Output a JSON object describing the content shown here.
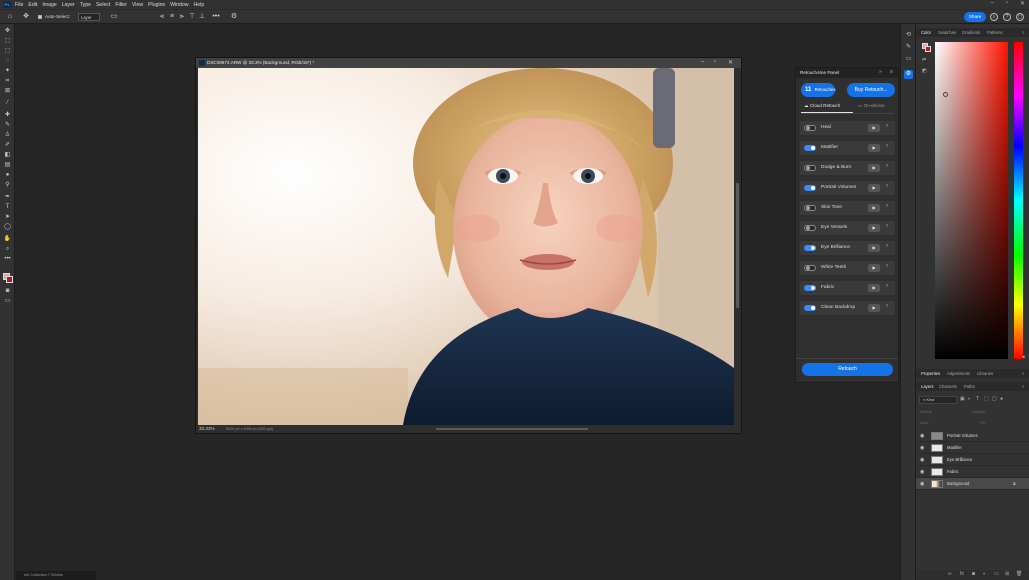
{
  "menu": {
    "items": [
      "File",
      "Edit",
      "Image",
      "Layer",
      "Type",
      "Select",
      "Filter",
      "View",
      "Plugins",
      "Window",
      "Help"
    ]
  },
  "options_bar": {
    "auto_select_label": "Auto-Select:",
    "auto_select_value": "Layer",
    "share_label": "Share"
  },
  "document": {
    "title": "DSC08674.ARW @ 33.3% (Background, RGB/16*) *",
    "zoom": "33.33%",
    "size": "6000 px x 4000 px (300 ppi)"
  },
  "retouch_panel": {
    "title": "Retouch4me Panel",
    "retouches_count": "11",
    "retouches_label": "Retouches",
    "buy_label": "Buy Retouch...",
    "tab_cloud": "Cloud Retouch",
    "tab_device": "On-device",
    "retouch_button": "Retouch",
    "items": [
      {
        "label": "Heal",
        "on": false
      },
      {
        "label": "Mattifier",
        "on": true
      },
      {
        "label": "Dodge & Burn",
        "on": false
      },
      {
        "label": "Portrait Volumes",
        "on": true
      },
      {
        "label": "Skin Tone",
        "on": false
      },
      {
        "label": "Eye Vessels",
        "on": false
      },
      {
        "label": "Eye Brilliance",
        "on": true
      },
      {
        "label": "White Teeth",
        "on": false
      },
      {
        "label": "Fabric",
        "on": true
      },
      {
        "label": "Clean Backdrop",
        "on": true
      }
    ]
  },
  "color_panel": {
    "tabs": [
      "Color",
      "Swatches",
      "Gradients",
      "Patterns"
    ],
    "foreground": "#e6a49a",
    "background": "#b01c20"
  },
  "properties_panel": {
    "tabs": [
      "Properties",
      "Adjustments",
      "Libraries"
    ]
  },
  "layers_panel": {
    "tabs": [
      "Layers",
      "Channels",
      "Paths"
    ],
    "filter_kind": "Kind",
    "blend_mode": "Normal",
    "opacity_label": "Opacity:",
    "lock_label": "Lock:",
    "fill_label": "Fill:",
    "layers": [
      {
        "name": "Portrait Volumes",
        "selected": false
      },
      {
        "name": "Mattifier",
        "selected": false
      },
      {
        "name": "Eye Brilliance",
        "selected": false
      },
      {
        "name": "Fabric",
        "selected": false
      },
      {
        "name": "Background",
        "selected": true
      }
    ]
  },
  "taskbar": {
    "label": "Ink Collection 7 Stories"
  }
}
